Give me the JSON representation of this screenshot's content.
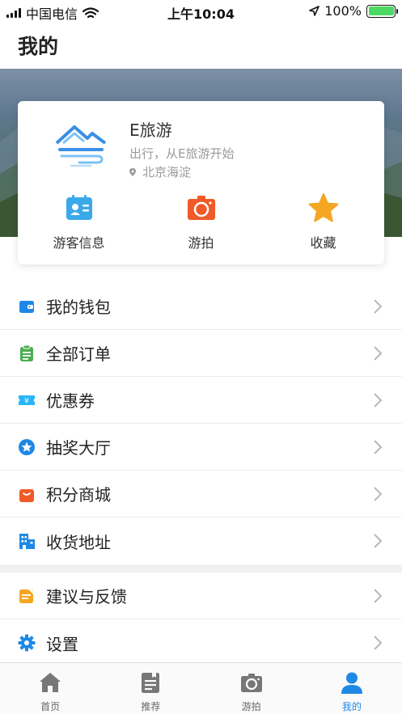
{
  "status_bar": {
    "carrier": "中国电信",
    "time": "上午10:04",
    "battery": "100%",
    "battery_level": 1.0
  },
  "header": {
    "title": "我的"
  },
  "profile": {
    "name": "E旅游",
    "slogan": "出行，从E旅游开始",
    "location": "北京海淀"
  },
  "quick_actions": [
    {
      "label": "游客信息",
      "icon": "id-card-icon",
      "color": "#3aa9ea"
    },
    {
      "label": "游拍",
      "icon": "camera-icon",
      "color": "#f05a28"
    },
    {
      "label": "收藏",
      "icon": "star-icon",
      "color": "#f5a623"
    }
  ],
  "menu": [
    {
      "label": "我的钱包",
      "icon": "wallet-icon",
      "color": "#1e88e5"
    },
    {
      "label": "全部订单",
      "icon": "clipboard-icon",
      "color": "#4caf50"
    },
    {
      "label": "优惠券",
      "icon": "coupon-icon",
      "color": "#29b6f6"
    },
    {
      "label": "抽奖大厅",
      "icon": "lottery-star-icon",
      "color": "#1e88e5"
    },
    {
      "label": "积分商城",
      "icon": "shopping-bag-icon",
      "color": "#f05a28"
    },
    {
      "label": "收货地址",
      "icon": "building-icon",
      "color": "#1e88e5"
    },
    {
      "label": "建议与反馈",
      "icon": "feedback-icon",
      "color": "#f5a623"
    },
    {
      "label": "设置",
      "icon": "gear-icon",
      "color": "#1e88e5"
    }
  ],
  "tabbar": [
    {
      "label": "首页",
      "icon": "home-icon",
      "active": false
    },
    {
      "label": "推荐",
      "icon": "recommend-icon",
      "active": false
    },
    {
      "label": "游拍",
      "icon": "camera-icon",
      "active": false
    },
    {
      "label": "我的",
      "icon": "user-icon",
      "active": true
    }
  ],
  "colors": {
    "accent": "#1e88e5",
    "inactive_tab": "#666666"
  }
}
